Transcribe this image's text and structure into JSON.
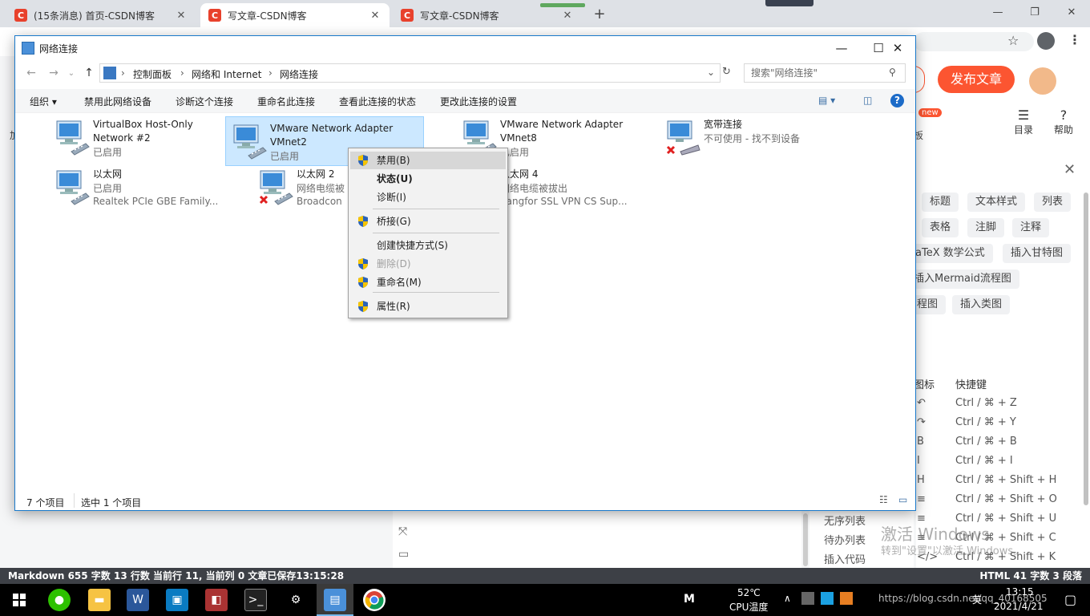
{
  "browser": {
    "tabs": [
      {
        "label": "(15条消息) 首页-CSDN博客",
        "icon": "C"
      },
      {
        "label": "写文章-CSDN博客",
        "icon": "C"
      },
      {
        "label": "写文章-CSDN博客",
        "icon": "C"
      }
    ],
    "new_tab": "+",
    "window_controls": {
      "minimize": "—",
      "maximize": "❐",
      "close": "✕"
    }
  },
  "csdn": {
    "publish_label": "发布文章",
    "new_badge": "new",
    "toolbar": [
      {
        "label": "目录"
      },
      {
        "label": "帮助"
      }
    ],
    "close": "✕",
    "chips": [
      "标题",
      "文本样式",
      "列表",
      "表格",
      "注脚",
      "注释",
      "aTeX 数学公式",
      "插入甘特图",
      "插入Mermaid流程图",
      "程图",
      "插入类图"
    ],
    "shortcut_header": {
      "col1": "图标",
      "col2": "快捷键"
    },
    "shortcuts": [
      {
        "icon": "↶",
        "keys": "Ctrl / ⌘ + Z"
      },
      {
        "icon": "↷",
        "keys": "Ctrl / ⌘ + Y"
      },
      {
        "icon": "B",
        "keys": "Ctrl / ⌘ + B"
      },
      {
        "icon": "I",
        "keys": "Ctrl / ⌘ + I"
      },
      {
        "icon": "H",
        "keys": "Ctrl / ⌘ + Shift + H"
      },
      {
        "icon": "≡",
        "keys": "Ctrl / ⌘ + Shift + O"
      },
      {
        "icon": "≡",
        "keys": "Ctrl / ⌘ + Shift + U"
      },
      {
        "icon": "≡",
        "keys": "Ctrl / ⌘ + Shift + C"
      },
      {
        "icon": "</>",
        "keys": "Ctrl / ⌘ + Shift + K"
      }
    ],
    "shortcut_names": [
      "无序列表",
      "待办列表",
      "插入代码"
    ],
    "side_label": "板",
    "left_edge": "加",
    "status_left": "Markdown  655 字数  13 行数  当前行 11, 当前列 0  文章已保存13:15:28",
    "status_right": "HTML  41 字数  3 段落"
  },
  "explorer": {
    "title": "网络连接",
    "breadcrumb": [
      "控制面板",
      "网络和 Internet",
      "网络连接"
    ],
    "search_placeholder": "搜索\"网络连接\"",
    "commands": [
      "组织 ▾",
      "禁用此网络设备",
      "诊断这个连接",
      "重命名此连接",
      "查看此连接的状态",
      "更改此连接的设置"
    ],
    "items": [
      {
        "name1": "VirtualBox Host-Only",
        "name2": "Network #2",
        "status": "已启用",
        "device": "",
        "error": false
      },
      {
        "name1": "VMware Network Adapter",
        "name2": "VMnet2",
        "status": "已启用",
        "device": "",
        "error": false
      },
      {
        "name1": "VMware Network Adapter",
        "name2": "VMnet8",
        "status": "已启用",
        "device": "",
        "error": false
      },
      {
        "name1": "宽带连接",
        "name2": "",
        "status": "不可使用 - 找不到设备",
        "device": "",
        "error": true
      },
      {
        "name1": "以太网",
        "name2": "",
        "status": "已启用",
        "device": "Realtek PCIe GBE Family...",
        "error": false
      },
      {
        "name1": "以太网 2",
        "name2": "",
        "status": "网络电缆被",
        "device": "Broadcon",
        "error": true
      },
      {
        "name1": "以太网 4",
        "name2": "",
        "status": "网络电缆被拔出",
        "device": "Sangfor SSL VPN CS Sup...",
        "error": false
      }
    ],
    "status_count": "7 个项目",
    "status_selected": "选中 1 个项目"
  },
  "context_menu": {
    "items": [
      {
        "label": "禁用(B)",
        "shield": true,
        "bold": false,
        "disabled": false,
        "highlight": true
      },
      {
        "label": "状态(U)",
        "shield": false,
        "bold": true,
        "disabled": false,
        "highlight": false
      },
      {
        "label": "诊断(I)",
        "shield": false,
        "bold": false,
        "disabled": false,
        "highlight": false
      },
      {
        "label": "桥接(G)",
        "shield": true,
        "bold": false,
        "disabled": false,
        "highlight": false
      },
      {
        "label": "创建快捷方式(S)",
        "shield": false,
        "bold": false,
        "disabled": false,
        "highlight": false
      },
      {
        "label": "删除(D)",
        "shield": true,
        "bold": false,
        "disabled": true,
        "highlight": false
      },
      {
        "label": "重命名(M)",
        "shield": true,
        "bold": false,
        "disabled": false,
        "highlight": false
      },
      {
        "label": "属性(R)",
        "shield": true,
        "bold": false,
        "disabled": false,
        "highlight": false
      }
    ]
  },
  "taskbar": {
    "temp": "52℃",
    "temp_label": "CPU温度",
    "ime": "英",
    "time": "13:15",
    "date": "2021/4/21",
    "m_label": "M"
  },
  "watermark": {
    "line1": "激活 Windows",
    "line2": "转到\"设置\"以激活 Windows。",
    "url_overlay": "https://blog.csdn.net/qq_40168505"
  }
}
